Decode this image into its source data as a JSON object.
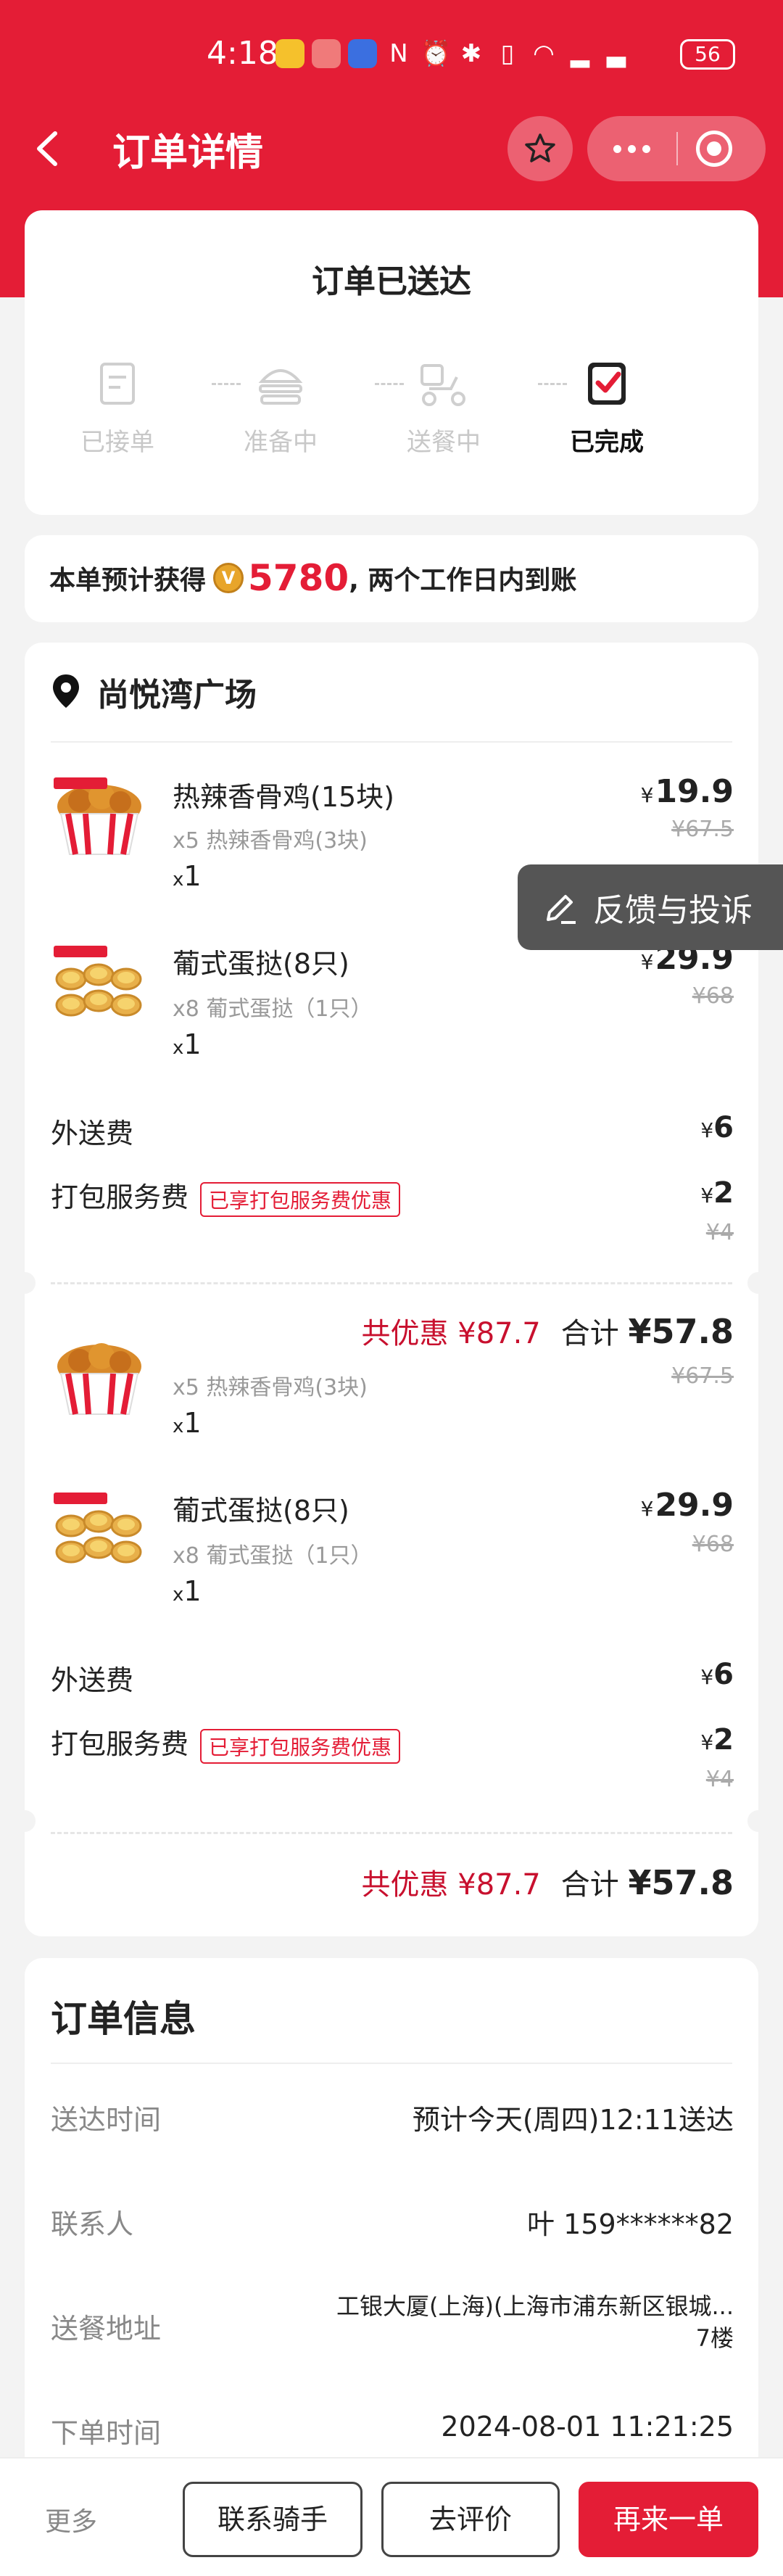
{
  "status_bar": {
    "time": "4:18",
    "battery": "56"
  },
  "header": {
    "title": "订单详情"
  },
  "status": {
    "title": "订单已送达",
    "steps": [
      {
        "label": "已接单"
      },
      {
        "label": "准备中"
      },
      {
        "label": "送餐中"
      },
      {
        "label": "已完成"
      }
    ]
  },
  "points": {
    "prefix": "本单预计获得",
    "amount": "5780",
    "suffix": ", 两个工作日内到账"
  },
  "order": {
    "store": "尚悦湾广场",
    "items": [
      {
        "name": "热辣香骨鸡(15块)",
        "detail": "x5 热辣香骨鸡(3块)",
        "qty_x": "x",
        "qty": "1",
        "currency": "¥",
        "price": "19.9",
        "original": "¥67.5"
      },
      {
        "name": "葡式蛋挞(8只)",
        "detail": "x8 葡式蛋挞（1只）",
        "qty_x": "x",
        "qty": "1",
        "currency": "¥",
        "price": "29.9",
        "original": "¥68"
      }
    ],
    "items_repeat": [
      {
        "detail": "x5 热辣香骨鸡(3块)",
        "qty_x": "x",
        "qty": "1",
        "original": "¥67.5"
      },
      {
        "name": "葡式蛋挞(8只)",
        "detail": "x8 葡式蛋挞（1只）",
        "qty_x": "x",
        "qty": "1",
        "currency": "¥",
        "price": "29.9",
        "original": "¥68"
      }
    ],
    "delivery_fee": {
      "label": "外送费",
      "currency": "¥",
      "price": "6"
    },
    "packing_fee": {
      "label": "打包服务费",
      "tag": "已享打包服务费优惠",
      "currency": "¥",
      "price": "2",
      "original": "¥4"
    },
    "total": {
      "discount": "共优惠 ¥87.7",
      "label": "合计",
      "amount": "¥57.8"
    }
  },
  "feedback": {
    "label": "反馈与投诉"
  },
  "info": {
    "title": "订单信息",
    "rows": [
      {
        "label": "送达时间",
        "value": "预计今天(周四)12:11送达"
      },
      {
        "label": "联系人",
        "value": "叶 159******82"
      },
      {
        "label": "送餐地址",
        "value": "工银大厦(上海)(上海市浦东新区银城...",
        "value2": "7楼"
      },
      {
        "label": "下单时间",
        "value": "2024-08-01 11:21:25"
      }
    ]
  },
  "bottom": {
    "more": "更多",
    "contact": "联系骑手",
    "review": "去评价",
    "reorder": "再来一单"
  },
  "colors": {
    "brand": "#e41d36",
    "discount": "#c8102e"
  }
}
